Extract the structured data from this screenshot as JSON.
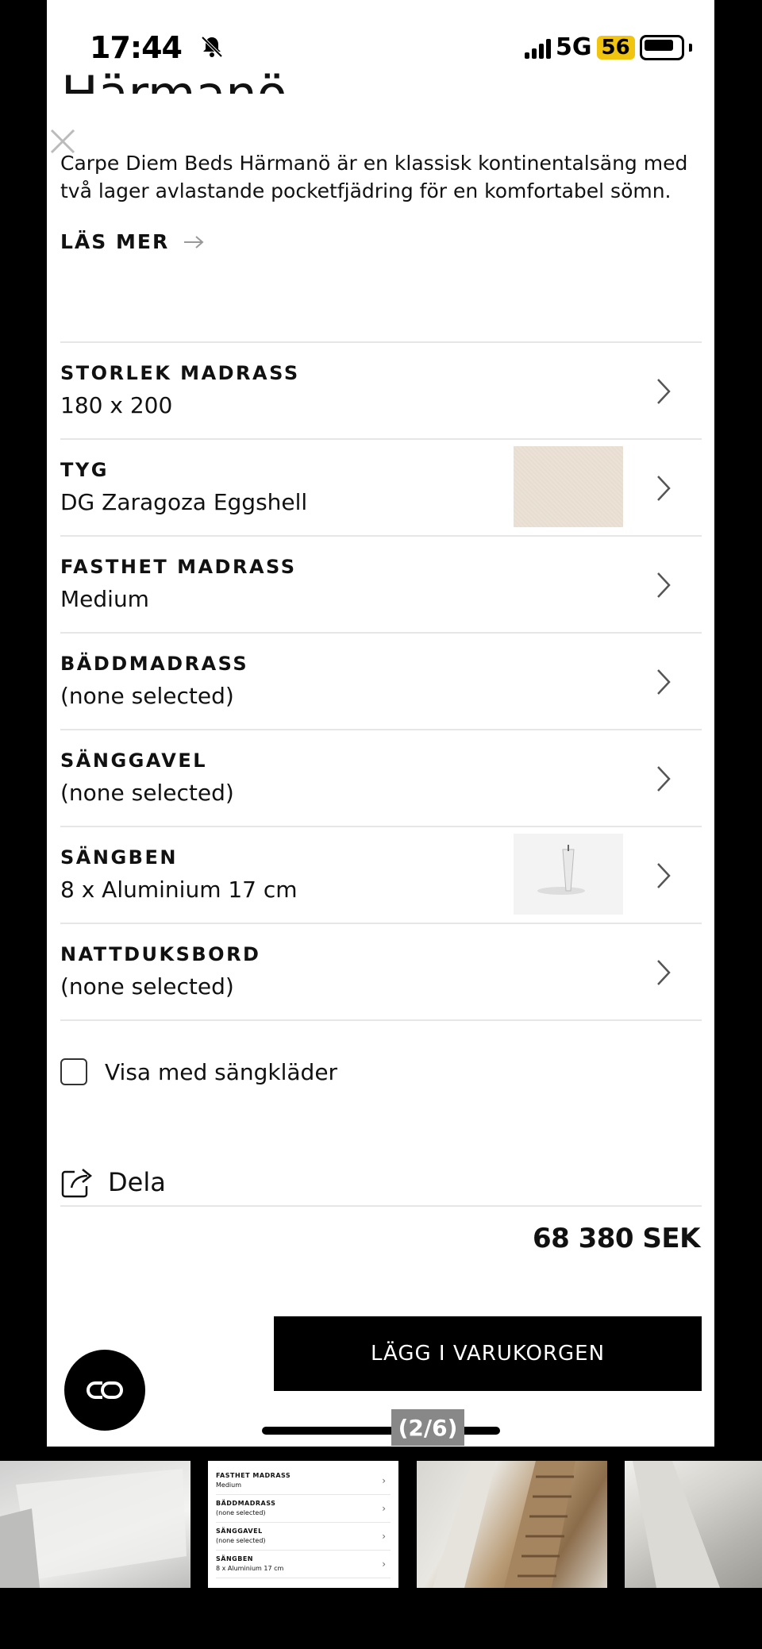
{
  "status_bar": {
    "time": "17:44",
    "network": "5G",
    "battery": "56"
  },
  "product": {
    "title_fragment": "Härmanö",
    "description": "Carpe Diem Beds Härmanö är en klassisk kontinentalsäng med två lager avlastande pocketfjädring för en komfortabel sömn.",
    "read_more": "LÄS MER"
  },
  "options": [
    {
      "label": "STORLEK MADRASS",
      "value": "180 x 200"
    },
    {
      "label": "TYG",
      "value": "DG Zaragoza Eggshell"
    },
    {
      "label": "FASTHET MADRASS",
      "value": "Medium"
    },
    {
      "label": "BÄDDMADRASS",
      "value": "(none selected)"
    },
    {
      "label": "SÄNGGAVEL",
      "value": "(none selected)"
    },
    {
      "label": "SÄNGBEN",
      "value": "8 x Aluminium 17 cm"
    },
    {
      "label": "NATTDUKSBORD",
      "value": "(none selected)"
    }
  ],
  "show_bedding": {
    "label": "Visa med sängkläder",
    "checked": false
  },
  "share": {
    "label": "Dela"
  },
  "price": "68 380 SEK",
  "cart_button": "LÄGG I VARUKORGEN",
  "page_indicator": "(2/6)",
  "thumbnail_preview": [
    {
      "label": "FASTHET MADRASS",
      "value": "Medium"
    },
    {
      "label": "BÄDDMADRASS",
      "value": "(none selected)"
    },
    {
      "label": "SÄNGGAVEL",
      "value": "(none selected)"
    },
    {
      "label": "SÄNGBEN",
      "value": "8 x Aluminium 17 cm"
    }
  ],
  "colors": {
    "background": "#000000",
    "surface": "#ffffff",
    "divider": "#e6e6e6",
    "fabric_swatch": "#e8ddd0",
    "battery_badge": "#f1c40f"
  }
}
